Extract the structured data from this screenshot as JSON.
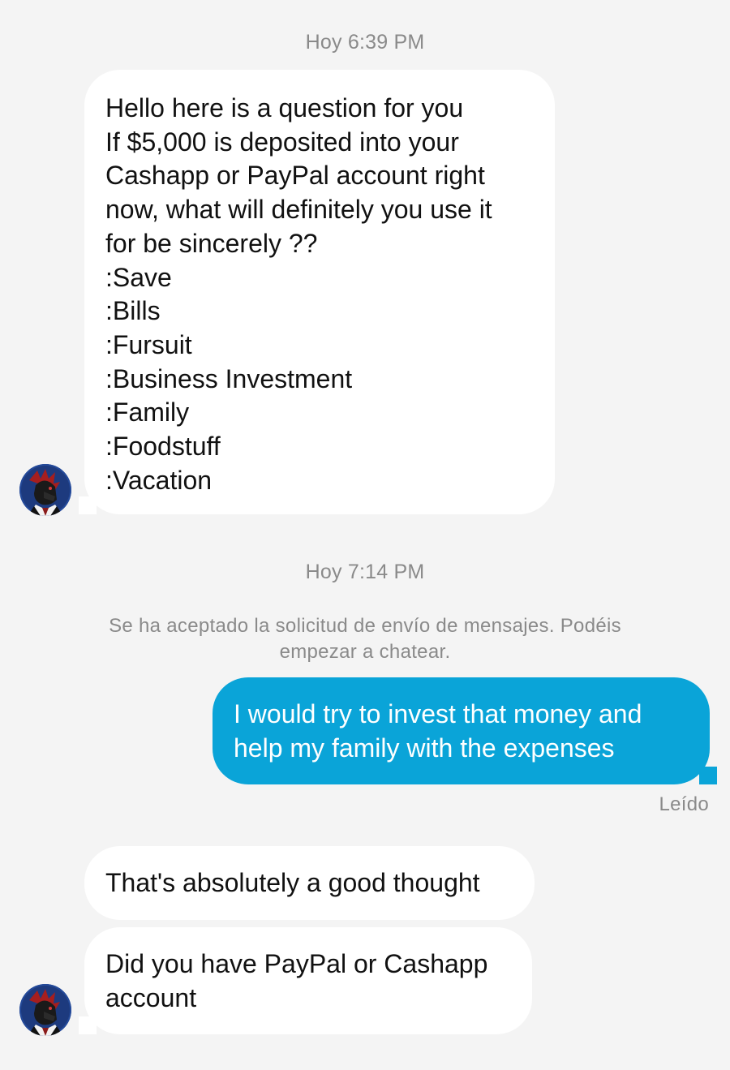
{
  "timestamps": {
    "first": "Hoy 6:39 PM",
    "second": "Hoy 7:14 PM"
  },
  "messages": {
    "incoming_1": {
      "lines": [
        "Hello here is a question for you",
        "If $5,000 is deposited into your",
        "Cashapp or PayPal account right",
        "now, what will definitely you use it",
        "for be sincerely ??",
        ":Save",
        ":Bills",
        ":Fursuit",
        ":Business Investment",
        ":Family",
        ":Foodstuff",
        ":Vacation"
      ]
    },
    "outgoing_1": {
      "lines": [
        "I would try to invest that money and",
        "help my family with the expenses"
      ]
    },
    "incoming_2": {
      "lines": [
        "That's absolutely a good thought"
      ]
    },
    "incoming_3": {
      "lines": [
        "Did you have PayPal or Cashapp",
        "account"
      ]
    }
  },
  "system_note": {
    "line1": "Se ha aceptado la solicitud de envío de mensajes. Podéis",
    "line2": "empezar a chatear."
  },
  "read_receipt": "Leído",
  "colors": {
    "background": "#f4f4f4",
    "incoming_bubble": "#ffffff",
    "outgoing_bubble": "#0aa4d8",
    "meta_text": "#8a8a8a"
  },
  "icons": {
    "avatar": "contact-avatar-icon"
  }
}
